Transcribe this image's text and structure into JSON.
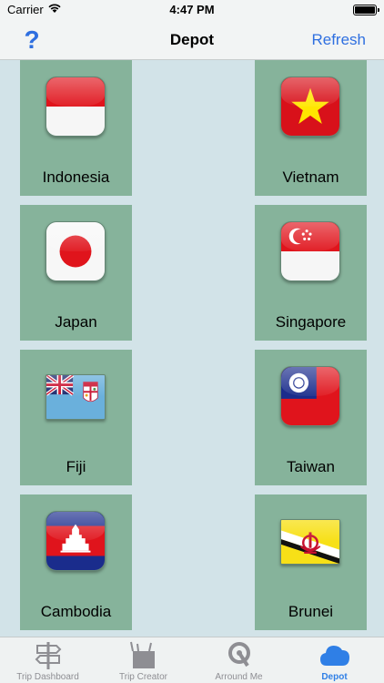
{
  "status": {
    "carrier": "Carrier",
    "time": "4:47 PM"
  },
  "nav": {
    "title": "Depot",
    "help_glyph": "?",
    "refresh_label": "Refresh"
  },
  "countries": [
    {
      "name": "Indonesia",
      "flag": "indonesia-flag-icon"
    },
    {
      "name": "Vietnam",
      "flag": "vietnam-flag-icon"
    },
    {
      "name": "Japan",
      "flag": "japan-flag-icon"
    },
    {
      "name": "Singapore",
      "flag": "singapore-flag-icon"
    },
    {
      "name": "Fiji",
      "flag": "fiji-flag-icon"
    },
    {
      "name": "Taiwan",
      "flag": "taiwan-flag-icon"
    },
    {
      "name": "Cambodia",
      "flag": "cambodia-flag-icon"
    },
    {
      "name": "Brunei",
      "flag": "brunei-flag-icon"
    }
  ],
  "tabs": [
    {
      "label": "Trip Dashboard",
      "icon": "signpost-icon"
    },
    {
      "label": "Trip Creator",
      "icon": "crate-icon"
    },
    {
      "label": "Arround Me",
      "icon": "radar-icon"
    },
    {
      "label": "Depot",
      "icon": "cloud-icon",
      "active": true
    }
  ],
  "colors": {
    "accent": "#2f7fe6",
    "tile": "#86b39b",
    "background": "#d2e3e8"
  }
}
